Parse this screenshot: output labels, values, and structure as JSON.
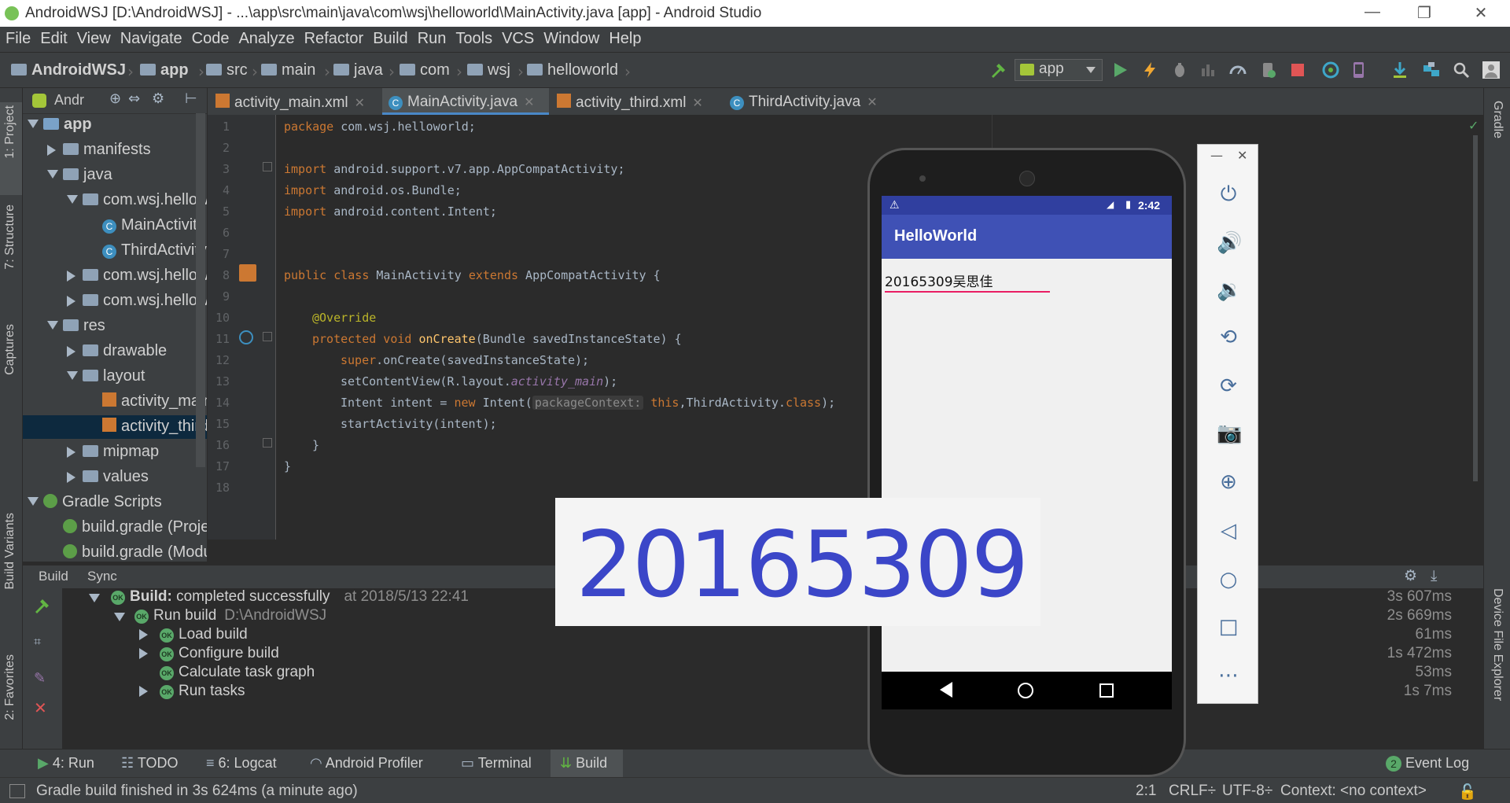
{
  "window": {
    "title": "AndroidWSJ [D:\\AndroidWSJ] - ...\\app\\src\\main\\java\\com\\wsj\\helloworld\\MainActivity.java [app] - Android Studio",
    "min": "—",
    "restore": "❐",
    "close": "✕"
  },
  "menu": [
    "File",
    "Edit",
    "View",
    "Navigate",
    "Code",
    "Analyze",
    "Refactor",
    "Build",
    "Run",
    "Tools",
    "VCS",
    "Window",
    "Help"
  ],
  "breadcrumbs": [
    "AndroidWSJ",
    "app",
    "src",
    "main",
    "java",
    "com",
    "wsj",
    "helloworld"
  ],
  "toolbar": {
    "run_config": "app"
  },
  "left_tabs": {
    "project": "1: Project",
    "structure": "7: Structure",
    "captures": "Captures",
    "build_variants": "Build Variants",
    "favorites": "2: Favorites"
  },
  "right_tabs": {
    "gradle": "Gradle",
    "device_file_explorer": "Device File Explorer"
  },
  "project_panel": {
    "view_label": "Andr",
    "tree": [
      {
        "label": "app",
        "level": 0,
        "icon": "module",
        "expanded": true
      },
      {
        "label": "manifests",
        "level": 1,
        "icon": "folder",
        "expanded": false
      },
      {
        "label": "java",
        "level": 1,
        "icon": "folder",
        "expanded": true
      },
      {
        "label": "com.wsj.hellowor",
        "level": 2,
        "icon": "package",
        "expanded": true
      },
      {
        "label": "MainActivity",
        "level": 3,
        "icon": "class"
      },
      {
        "label": "ThirdActivity",
        "level": 3,
        "icon": "class"
      },
      {
        "label": "com.wsj.hellowor",
        "level": 2,
        "icon": "package",
        "expanded": false
      },
      {
        "label": "com.wsj.hellowor",
        "level": 2,
        "icon": "package",
        "expanded": false
      },
      {
        "label": "res",
        "level": 1,
        "icon": "folder",
        "expanded": true
      },
      {
        "label": "drawable",
        "level": 2,
        "icon": "folder",
        "expanded": false
      },
      {
        "label": "layout",
        "level": 2,
        "icon": "folder",
        "expanded": true
      },
      {
        "label": "activity_main.",
        "level": 3,
        "icon": "xml"
      },
      {
        "label": "activity_third.",
        "level": 3,
        "icon": "xml",
        "selected": true
      },
      {
        "label": "mipmap",
        "level": 2,
        "icon": "folder",
        "expanded": false
      },
      {
        "label": "values",
        "level": 2,
        "icon": "folder",
        "expanded": false
      },
      {
        "label": "Gradle Scripts",
        "level": 0,
        "icon": "gradle",
        "expanded": true
      },
      {
        "label": "build.gradle (Project",
        "level": 1,
        "icon": "gradle"
      },
      {
        "label": "build.gradle (Modul",
        "level": 1,
        "icon": "gradle"
      }
    ]
  },
  "editor_tabs": [
    {
      "label": "activity_main.xml",
      "icon": "xml",
      "active": false
    },
    {
      "label": "MainActivity.java",
      "icon": "class",
      "active": true
    },
    {
      "label": "activity_third.xml",
      "icon": "xml",
      "active": false
    },
    {
      "label": "ThirdActivity.java",
      "icon": "class",
      "active": false
    }
  ],
  "code": {
    "line_numbers": [
      "1",
      "2",
      "3",
      "4",
      "5",
      "6",
      "7",
      "8",
      "9",
      "10",
      "11",
      "12",
      "13",
      "14",
      "15",
      "16",
      "17",
      "18"
    ],
    "l1_kw": "package",
    "l1_rest": " com.wsj.helloworld;",
    "l3_kw": "import",
    "l3_rest": " android.support.v7.app.AppCompatActivity;",
    "l4_kw": "import",
    "l4_rest": " android.os.Bundle;",
    "l5_kw": "import",
    "l5_rest": " android.content.Intent;",
    "l8_kw1": "public class",
    "l8_name": " MainActivity ",
    "l8_kw2": "extends",
    "l8_rest": " AppCompatActivity {",
    "l10_ann": "@Override",
    "l11_kw": "protected void",
    "l11_fn": " onCreate",
    "l11_rest": "(Bundle savedInstanceState) {",
    "l12_kw": "super",
    "l12_rest": ".onCreate(savedInstanceState);",
    "l13_pre": "setContentView(R.layout.",
    "l13_it": "activity_main",
    "l13_post": ");",
    "l14_pre": "Intent intent = ",
    "l14_kw": "new",
    "l14_mid": " Intent(",
    "l14_hint": "packageContext:",
    "l14_this": " this",
    "l14_post": ",ThirdActivity.",
    "l14_cls": "class",
    "l14_end": ");",
    "l15": "startActivity(intent);",
    "l16": "}",
    "l17": "}"
  },
  "build": {
    "tabs": [
      "Build",
      "Sync"
    ],
    "rows": [
      {
        "bold": "Build:",
        "text": " completed successfully",
        "extra": "at 2018/5/13 22:41",
        "time": "3s 607ms"
      },
      {
        "text": "Run build",
        "extra": "D:\\AndroidWSJ",
        "time": "2s 669ms"
      },
      {
        "text": "Load build",
        "time": "61ms"
      },
      {
        "text": "Configure build",
        "time": "1s 472ms"
      },
      {
        "text": "Calculate task graph",
        "time": "53ms"
      },
      {
        "text": "Run tasks",
        "time": "1s 7ms"
      }
    ]
  },
  "bottom_tabs": [
    {
      "label": "4: Run"
    },
    {
      "label": "TODO"
    },
    {
      "label": "6: Logcat"
    },
    {
      "label": "Android Profiler"
    },
    {
      "label": "Terminal"
    },
    {
      "label": "Build"
    }
  ],
  "event_log": {
    "count": "2",
    "label": "Event Log"
  },
  "status": {
    "message": "Gradle build finished in 3s 624ms (a minute ago)",
    "position": "2:1",
    "line_sep": "CRLF÷",
    "encoding": "UTF-8÷",
    "context": "Context: <no context>"
  },
  "emulator": {
    "status_time": "2:42",
    "app_title": "HelloWorld",
    "text_field": "20165309吴思佳"
  },
  "overlay_text": "20165309",
  "colors": {
    "accent": "#4a88c7",
    "app_bar": "#3f51b5",
    "status_bar": "#303f9f",
    "overlay_text": "#3b46c8"
  }
}
